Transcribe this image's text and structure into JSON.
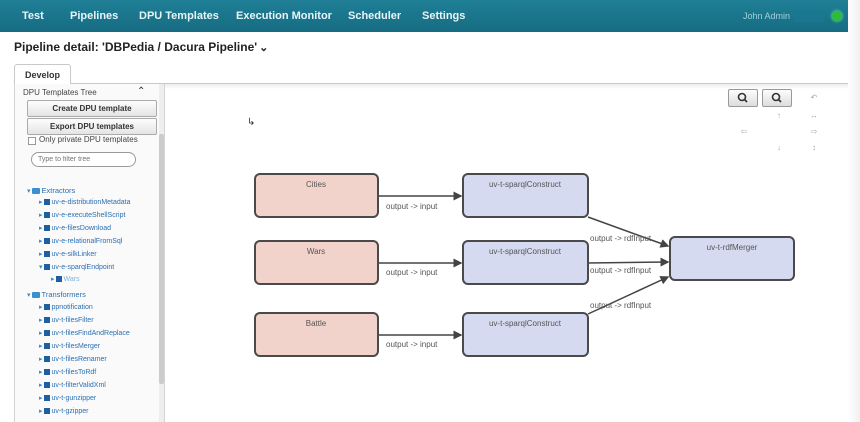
{
  "nav": {
    "items": [
      "Test",
      "Pipelines",
      "DPU Templates",
      "Execution Monitor",
      "Scheduler",
      "Settings"
    ],
    "user": "John Admin"
  },
  "page": {
    "title": "Pipeline detail: 'DBPedia / Dacura Pipeline'"
  },
  "tabs": {
    "develop": "Develop"
  },
  "sidebar": {
    "tree_title": "DPU Templates Tree",
    "create_button": "Create DPU template",
    "export_button": "Export DPU templates",
    "only_private": "Only private DPU templates",
    "filter_placeholder": "Type to filter tree",
    "groups": {
      "extractors": "Extractors",
      "transformers": "Transformers"
    },
    "extractors": [
      "uv-e-distributionMetadata",
      "uv-e-executeShellScript",
      "uv-e-filesDownload",
      "uv-e-relationalFromSql",
      "uv-e-silkLinker",
      "uv-e-sparqlEndpoint"
    ],
    "extractor_child": "Wars",
    "transformers": [
      "ppnotification",
      "uv-t-filesFilter",
      "uv-t-filesFindAndReplace",
      "uv-t-filesMerger",
      "uv-t-filesRenamer",
      "uv-t-filesToRdf",
      "uv-t-filterValidXml",
      "uv-t-gunzipper",
      "uv-t-gzipper"
    ]
  },
  "graph": {
    "sources": [
      "Cities",
      "Wars",
      "Battle"
    ],
    "constructs": [
      "uv-t-sparqlConstruct",
      "uv-t-sparqlConstruct",
      "uv-t-sparqlConstruct"
    ],
    "merger": "uv-t-rdfMerger",
    "edge_source": "output -> input",
    "edge_merge": "output -> rdfInput",
    "edge_merge_3": "output -> rdfInput",
    "colors": {
      "source_fill": "#f2d3cc",
      "transform_fill": "#d5daf0",
      "border": "#4a4a4a"
    }
  }
}
